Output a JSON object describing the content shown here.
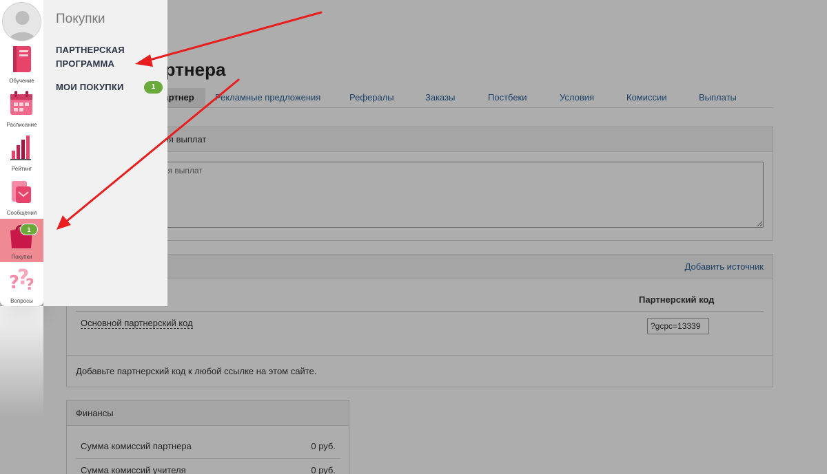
{
  "page": {
    "title": "Кабинет партнера",
    "tabs": [
      {
        "label": "Партнер",
        "active": true
      },
      {
        "label": "Рекламные предложения",
        "active": false
      },
      {
        "label": "Рефералы",
        "active": false
      },
      {
        "label": "Заказы",
        "active": false
      },
      {
        "label": "Постбеки",
        "active": false
      },
      {
        "label": "Условия",
        "active": false
      },
      {
        "label": "Комиссии",
        "active": false
      },
      {
        "label": "Выплаты",
        "active": false
      }
    ],
    "payout_panel": {
      "header": "Способ осуществления выплат",
      "textarea_placeholder": "Способ осуществления выплат"
    },
    "codes_panel": {
      "add_source_label": "Добавить источник",
      "column_header": "Партнерский код",
      "row_name": "Основной партнерский код",
      "row_code": "?gcpc=13339",
      "hint": "Добавьте партнерский код к любой ссылке на этом сайте."
    },
    "finance_panel": {
      "header": "Финансы",
      "rows": [
        {
          "label": "Сумма комиссий партнера",
          "value": "0 руб."
        },
        {
          "label": "Сумма комиссий учителя",
          "value": "0 руб."
        }
      ]
    }
  },
  "sidebar": {
    "items": [
      {
        "label": "Обучение",
        "icon": "notebook-icon"
      },
      {
        "label": "Расписание",
        "icon": "calendar-icon"
      },
      {
        "label": "Рейтинг",
        "icon": "rating-chart-icon"
      },
      {
        "label": "Сообщения",
        "icon": "messages-icon"
      },
      {
        "label": "Покупки",
        "icon": "shopping-bag-icon",
        "active": true,
        "badge": "1"
      },
      {
        "label": "Вопросы",
        "icon": "question-marks-icon"
      }
    ]
  },
  "drawer": {
    "title": "Покупки",
    "links": [
      {
        "line1": "ПАРТНЕРСКАЯ",
        "line2": "ПРОГРАММА"
      },
      {
        "line1": "МОИ ПОКУПКИ",
        "badge": "1"
      }
    ]
  },
  "colors": {
    "accent_pink": "#e8436a",
    "badge_green": "#6aaa3a",
    "active_item": "#ef8a93",
    "arrow_red": "#e81d1d",
    "link_blue": "#2b5f96"
  }
}
